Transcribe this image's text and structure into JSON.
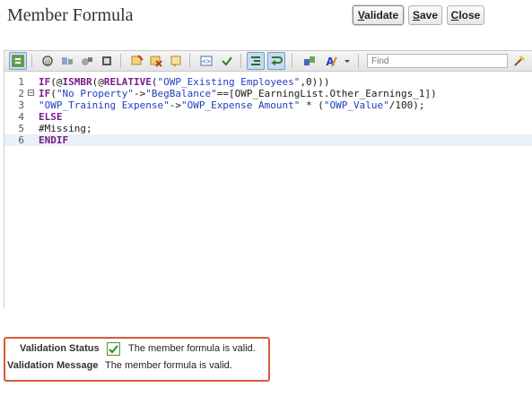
{
  "header": {
    "title": "Member Formula",
    "buttons": {
      "validate_pre": "",
      "validate_u": "V",
      "validate_post": "alidate",
      "save_pre": "",
      "save_u": "S",
      "save_post": "ave",
      "close_pre": "",
      "close_u": "C",
      "close_post": "lose"
    }
  },
  "toolbar": {
    "find_placeholder": "Find",
    "icons": [
      "member-selector-icon",
      "function-icon",
      "insert-dimension-icon",
      "insert-member-icon",
      "comment-icon",
      "check-icon",
      "remove-icon",
      "tag-icon",
      "brackets-icon",
      "check-syntax-icon",
      "indent-icon",
      "wrap-icon",
      "cube-icon",
      "font-icon",
      "dropdown-arrow-icon",
      "find-next-icon"
    ]
  },
  "editor": {
    "lines": [
      {
        "num": "1",
        "segments": [
          [
            "kw",
            "IF"
          ],
          [
            "plain",
            "(@"
          ],
          [
            "kw",
            "ISMBR"
          ],
          [
            "plain",
            "(@"
          ],
          [
            "kw",
            "RELATIVE"
          ],
          [
            "plain",
            "("
          ],
          [
            "str",
            "\"OWP_Existing Employees\""
          ],
          [
            "plain",
            ",0)))"
          ]
        ]
      },
      {
        "num": "2",
        "fold": true,
        "segments": [
          [
            "kw",
            "IF"
          ],
          [
            "plain",
            "("
          ],
          [
            "str",
            "\"No Property\""
          ],
          [
            "plain",
            "->"
          ],
          [
            "str",
            "\"BegBalance\""
          ],
          [
            "plain",
            "==[OWP_EarningList.Other_Earnings_1])"
          ]
        ]
      },
      {
        "num": "3",
        "segments": [
          [
            "str",
            "\"OWP_Training Expense\""
          ],
          [
            "plain",
            "->"
          ],
          [
            "str",
            "\"OWP_Expense Amount\""
          ],
          [
            "plain",
            " * ("
          ],
          [
            "str",
            "\"OWP_Value\""
          ],
          [
            "plain",
            "/100);"
          ]
        ]
      },
      {
        "num": "4",
        "segments": [
          [
            "kw",
            "ELSE"
          ]
        ]
      },
      {
        "num": "5",
        "segments": [
          [
            "plain",
            "#Missing;"
          ]
        ]
      },
      {
        "num": "6",
        "active": true,
        "segments": [
          [
            "kw",
            "ENDIF"
          ]
        ]
      }
    ]
  },
  "validation": {
    "status_label": "Validation Status",
    "status_text": "The member formula is valid.",
    "message_label": "Validation Message",
    "message_text": "The member formula is valid."
  }
}
